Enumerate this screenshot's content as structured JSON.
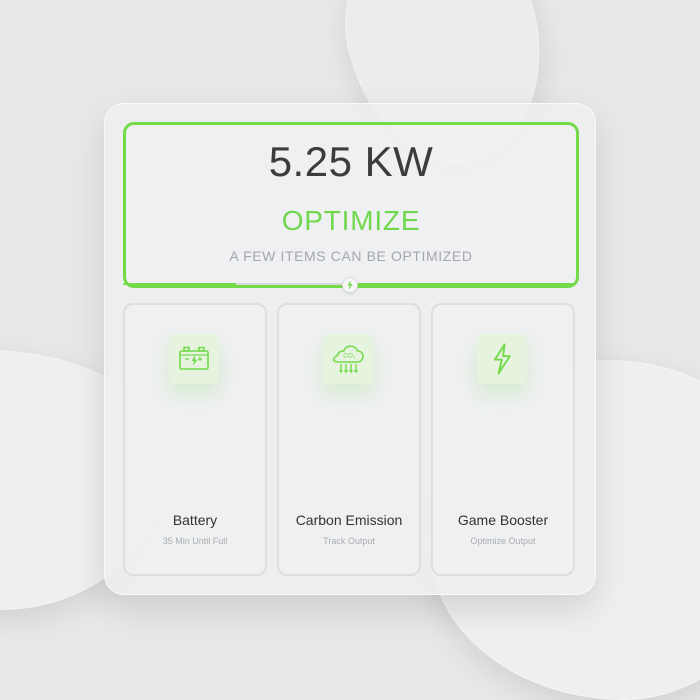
{
  "summary": {
    "power": "5.25 KW",
    "status": "OPTIMIZE",
    "message": "A FEW ITEMS CAN BE OPTIMIZED",
    "progress": {
      "left_fill_percent": 0.25,
      "right_fill_percent": 0.49
    }
  },
  "tiles": [
    {
      "title": "Battery",
      "subtitle": "35 Min Until Full",
      "icon": "battery-charging-icon"
    },
    {
      "title": "Carbon Emission",
      "subtitle": "Track Output",
      "icon": "co2-cloud-icon"
    },
    {
      "title": "Game Booster",
      "subtitle": "Optimize Output",
      "icon": "lightning-icon"
    }
  ],
  "colors": {
    "accent": "#74DA4A",
    "text_primary": "#3C3C3C",
    "text_secondary": "#A4A7AB",
    "surface": "#EEEFF0"
  }
}
